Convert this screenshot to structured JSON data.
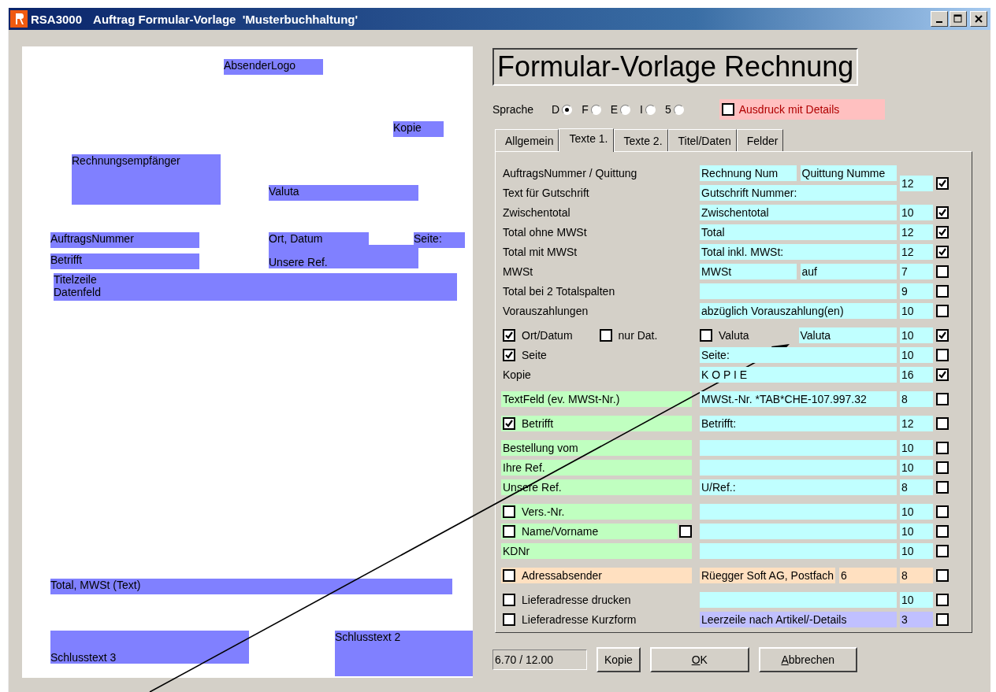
{
  "window": {
    "app": "RSA3000",
    "title": "Auftrag Formular-Vorlage  'Musterbuchhaltung'"
  },
  "layout_fields": [
    {
      "lines": [
        "AbsenderLogo"
      ]
    },
    {
      "lines": [
        "Kopie"
      ]
    },
    {
      "lines": [
        "Rechnungsempfänger"
      ]
    },
    {
      "lines": [
        "Valuta"
      ]
    },
    {
      "lines": [
        "AuftragsNummer"
      ]
    },
    {
      "lines": [
        "Ort, Datum"
      ]
    },
    {
      "lines": [
        "Unsere Ref."
      ]
    },
    {
      "lines": [
        "Seite:"
      ]
    },
    {
      "lines": [
        "Betrifft"
      ]
    },
    {
      "lines": [
        "Titelzeile",
        "Datenfeld"
      ]
    },
    {
      "lines": [
        "Total, MWSt (Text)"
      ]
    },
    {
      "lines": [
        "Schlusstext 3"
      ]
    },
    {
      "lines": [
        "Schlusstext 2"
      ]
    }
  ],
  "form_title": "Formular-Vorlage Rechnung",
  "language": {
    "label": "Sprache",
    "options": [
      {
        "label": "D",
        "selected": true
      },
      {
        "label": "F",
        "selected": false
      },
      {
        "label": "E",
        "selected": false
      },
      {
        "label": "I",
        "selected": false
      },
      {
        "label": "5",
        "selected": false
      }
    ]
  },
  "details_option": {
    "label": "Ausdruck mit Details",
    "checked": false,
    "color": "#ffc0c0"
  },
  "tabs": [
    {
      "label": "Allgemein",
      "selected": false
    },
    {
      "label": "Texte 1.",
      "selected": true
    },
    {
      "label": "Texte 2.",
      "selected": false
    },
    {
      "label": "Titel/Daten",
      "selected": false
    },
    {
      "label": "Felder",
      "selected": false
    }
  ],
  "sections": [
    {
      "rows": [
        {
          "label": {
            "parts": [
              {
                "kind": "text",
                "text": "AuftragsNummer / Quittung"
              }
            ]
          },
          "values": [
            {
              "text": "Rechnung Num",
              "color": "#c0ffff"
            },
            {
              "text": "Quittung Numme",
              "color": "#c0ffff"
            }
          ],
          "size": {
            "text": "12",
            "color": "#c0ffff"
          },
          "print": true
        },
        {
          "label": {
            "parts": [
              {
                "kind": "text",
                "text": "Text für Gutschrift"
              }
            ]
          },
          "values": [
            {
              "text": "Gutschrift Nummer:",
              "color": "#c0ffff"
            }
          ]
        },
        {
          "label": {
            "parts": [
              {
                "kind": "text",
                "text": "Zwischentotal"
              }
            ]
          },
          "values": [
            {
              "text": "Zwischentotal",
              "color": "#c0ffff"
            }
          ],
          "size": {
            "text": "10",
            "color": "#c0ffff"
          },
          "print": true
        },
        {
          "label": {
            "parts": [
              {
                "kind": "text",
                "text": "Total ohne MWSt"
              }
            ]
          },
          "values": [
            {
              "text": "Total",
              "color": "#c0ffff"
            }
          ],
          "size": {
            "text": "12",
            "color": "#c0ffff"
          },
          "print": true
        },
        {
          "label": {
            "parts": [
              {
                "kind": "text",
                "text": "Total mit MWSt"
              }
            ]
          },
          "values": [
            {
              "text": "Total inkl. MWSt:",
              "color": "#c0ffff"
            }
          ],
          "size": {
            "text": "12",
            "color": "#c0ffff"
          },
          "print": true
        },
        {
          "label": {
            "parts": [
              {
                "kind": "text",
                "text": "MWSt"
              }
            ]
          },
          "values": [
            {
              "text": "MWSt",
              "color": "#c0ffff"
            },
            {
              "text": "auf",
              "color": "#c0ffff"
            }
          ],
          "size": {
            "text": "7",
            "color": "#c0ffff"
          },
          "print": false
        },
        {
          "label": {
            "parts": [
              {
                "kind": "text",
                "text": "Total bei 2 Totalspalten"
              }
            ]
          },
          "values": [
            {
              "color": "#c0ffff"
            }
          ],
          "size": {
            "text": "9",
            "color": "#c0ffff"
          },
          "print": false
        },
        {
          "label": {
            "parts": [
              {
                "kind": "text",
                "text": "Vorauszahlungen"
              }
            ]
          },
          "values": [
            {
              "text": "abzüglich Vorauszahlung(en)",
              "color": "#c0ffff"
            }
          ],
          "size": {
            "text": "10",
            "color": "#c0ffff"
          },
          "print": false
        }
      ]
    },
    {
      "rows": [
        {
          "label": {
            "parts": [
              {
                "kind": "check",
                "text": "Ort/Datum",
                "checked": true
              },
              {
                "kind": "check",
                "text": "nur Dat.",
                "checked": false
              }
            ]
          },
          "values": [
            {
              "kind": "check",
              "text": "Valuta",
              "checked": false
            },
            {
              "text": "Valuta",
              "color": "#c0ffff"
            }
          ],
          "size": {
            "text": "10",
            "color": "#c0ffff"
          },
          "print": true
        },
        {
          "label": {
            "parts": [
              {
                "kind": "check",
                "text": "Seite",
                "checked": true
              }
            ]
          },
          "values": [
            {
              "text": "Seite:",
              "color": "#c0ffff"
            }
          ],
          "size": {
            "text": "10",
            "color": "#c0ffff"
          },
          "print": false
        },
        {
          "label": {
            "parts": [
              {
                "kind": "text",
                "text": "Kopie"
              }
            ]
          },
          "values": [
            {
              "text": "K O P I E",
              "color": "#c0ffff"
            }
          ],
          "size": {
            "text": "16",
            "color": "#c0ffff"
          },
          "print": true
        }
      ]
    },
    {
      "rows": [
        {
          "label": {
            "color": "#c0ffc0",
            "parts": [
              {
                "kind": "text",
                "text": "TextFeld (ev. MWSt-Nr.)"
              }
            ]
          },
          "values": [
            {
              "text": "MWSt.-Nr. *TAB*CHE-107.997.32",
              "color": "#c0ffff"
            }
          ],
          "size": {
            "text": "8",
            "color": "#c0ffff"
          },
          "print": false
        }
      ]
    },
    {
      "rows": [
        {
          "label": {
            "color": "#c0ffc0",
            "parts": [
              {
                "kind": "check",
                "text": "Betrifft",
                "checked": true
              }
            ]
          },
          "values": [
            {
              "text": "Betrifft:",
              "color": "#c0ffff"
            }
          ],
          "size": {
            "text": "12",
            "color": "#c0ffff"
          },
          "print": false
        }
      ]
    },
    {
      "rows": [
        {
          "label": {
            "color": "#c0ffc0",
            "parts": [
              {
                "kind": "text",
                "text": "Bestellung vom"
              }
            ]
          },
          "values": [
            {
              "color": "#c0ffff"
            }
          ],
          "size": {
            "text": "10",
            "color": "#c0ffff"
          },
          "print": false
        },
        {
          "label": {
            "color": "#c0ffc0",
            "parts": [
              {
                "kind": "text",
                "text": "Ihre Ref."
              }
            ]
          },
          "values": [
            {
              "color": "#c0ffff"
            }
          ],
          "size": {
            "text": "10",
            "color": "#c0ffff"
          },
          "print": false
        },
        {
          "label": {
            "color": "#c0ffc0",
            "parts": [
              {
                "kind": "text",
                "text": "Unsere Ref."
              }
            ]
          },
          "values": [
            {
              "text": "U/Ref.:",
              "color": "#c0ffff"
            }
          ],
          "size": {
            "text": "8",
            "color": "#c0ffff"
          },
          "print": false
        }
      ]
    },
    {
      "rows": [
        {
          "label": {
            "color": "#c0ffc0",
            "parts": [
              {
                "kind": "check",
                "text": "Vers.-Nr.",
                "checked": false
              }
            ]
          },
          "values": [
            {
              "color": "#c0ffff"
            }
          ],
          "size": {
            "text": "10",
            "color": "#c0ffff"
          },
          "print": false
        },
        {
          "label": {
            "color": "#c0ffc0",
            "parts": [
              {
                "kind": "check",
                "text": "Name/Vorname",
                "checked": false
              },
              {
                "kind": "check",
                "checked": false
              }
            ]
          },
          "values": [
            {
              "color": "#c0ffff"
            }
          ],
          "size": {
            "text": "10",
            "color": "#c0ffff"
          },
          "print": false
        },
        {
          "label": {
            "color": "#c0ffc0",
            "parts": [
              {
                "kind": "text",
                "text": "KDNr"
              }
            ]
          },
          "values": [
            {
              "color": "#c0ffff"
            }
          ],
          "size": {
            "text": "10",
            "color": "#c0ffff"
          },
          "print": false
        }
      ]
    },
    {
      "rows": [
        {
          "label": {
            "color": "#ffe0c0",
            "parts": [
              {
                "kind": "check",
                "text": "Adressabsender",
                "checked": false
              }
            ]
          },
          "values": [
            {
              "text": "Rüegger Soft AG, Postfach",
              "color": "#ffe0c0"
            },
            {
              "text": "6",
              "color": "#ffe0c0"
            }
          ],
          "size": {
            "text": "8",
            "color": "#ffe0c0"
          },
          "print": false
        }
      ]
    },
    {
      "rows": [
        {
          "label": {
            "parts": [
              {
                "kind": "check",
                "text": "Lieferadresse drucken",
                "checked": false
              }
            ]
          },
          "values": [
            {
              "color": "#c0ffff"
            }
          ],
          "size": {
            "text": "10",
            "color": "#c0ffff"
          },
          "print": false
        },
        {
          "label": {
            "parts": [
              {
                "kind": "check",
                "text": "Lieferadresse Kurzform",
                "checked": false
              }
            ]
          },
          "values": [
            {
              "text": "Leerzeile nach Artikel/-Details",
              "color": "#c0c0ff"
            }
          ],
          "size": {
            "text": "3",
            "color": "#c0c0ff"
          },
          "print": false
        }
      ]
    }
  ],
  "status_field": "6.70 / 12.00",
  "buttons": [
    {
      "label": "Kopie",
      "underline_first": false
    },
    {
      "label": "OK",
      "underline_first": true
    },
    {
      "label": "Abbrechen",
      "underline_first": true
    }
  ]
}
